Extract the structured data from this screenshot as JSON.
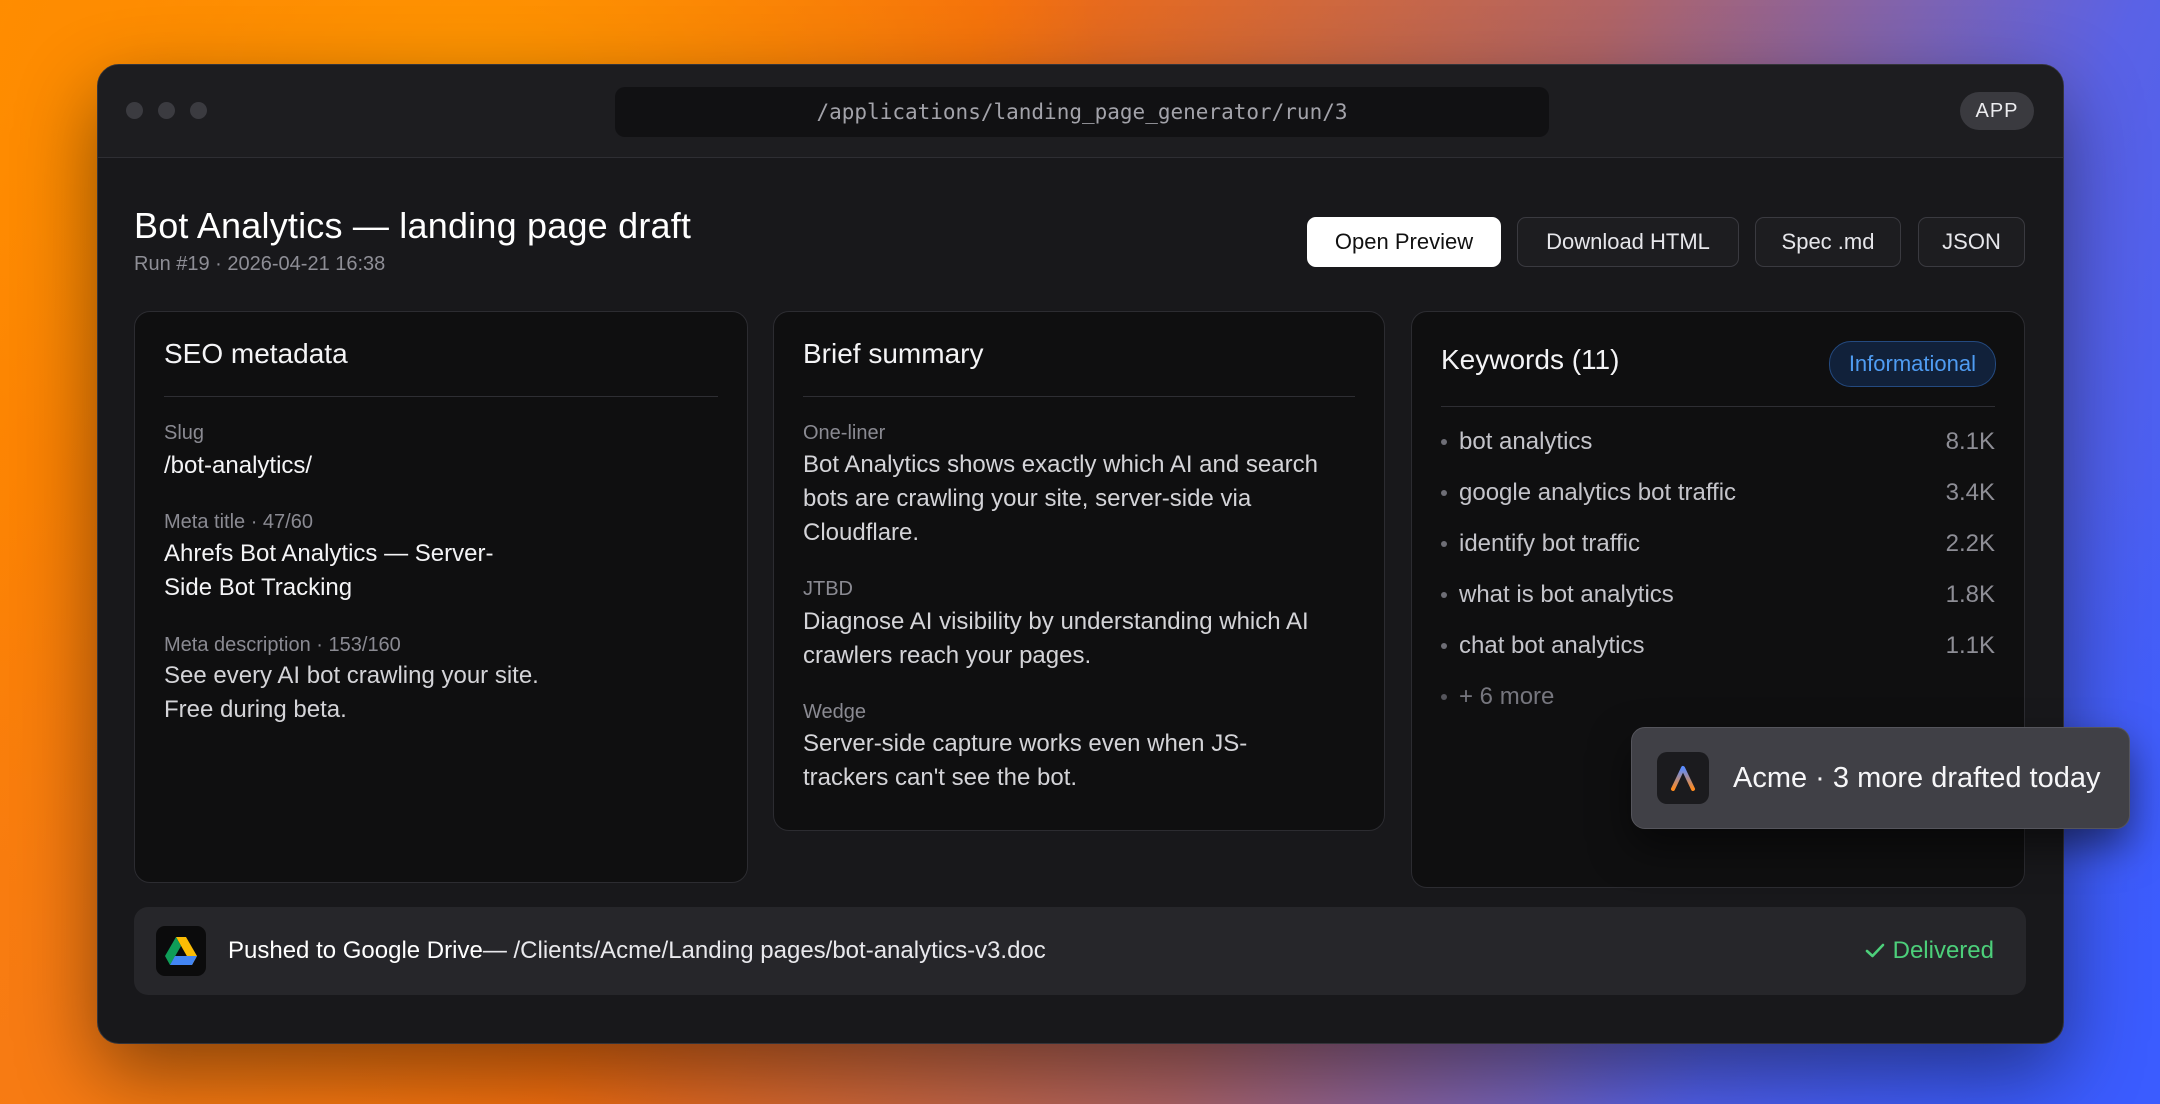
{
  "window": {
    "url": "/applications/landing_page_generator/run/3",
    "badge": "APP"
  },
  "header": {
    "title": "Bot Analytics — landing page draft",
    "subtitle": "Run #19 · 2026-04-21 16:38"
  },
  "actions": {
    "open_preview": "Open Preview",
    "download_html": "Download HTML",
    "spec_md": "Spec .md",
    "json": "JSON"
  },
  "seo": {
    "title": "SEO metadata",
    "slug_label": "Slug",
    "slug": "/bot-analytics/",
    "meta_title_label": "Meta title · 47/60",
    "meta_title_line1": "Ahrefs Bot Analytics — Server-",
    "meta_title_line2": "Side Bot Tracking",
    "meta_desc_label": "Meta description · 153/160",
    "meta_desc_line1": "See every AI bot crawling your site.",
    "meta_desc_line2": "Free during beta."
  },
  "brief": {
    "title": "Brief summary",
    "oneliner_label": "One-liner",
    "oneliner_lines": [
      "Bot Analytics shows exactly which AI and search",
      "bots are crawling your site, server-side via",
      "Cloudflare."
    ],
    "jtbd_label": "JTBD",
    "jtbd_lines": [
      "Diagnose AI visibility by understanding which AI",
      "crawlers reach your pages."
    ],
    "wedge_label": "Wedge",
    "wedge_lines": [
      "Server-side capture works even when JS-",
      "trackers can't see the bot."
    ]
  },
  "keywords": {
    "title": "Keywords (11)",
    "intent": "Informational",
    "items": [
      {
        "term": "bot analytics",
        "volume": "8.1K"
      },
      {
        "term": "google analytics bot traffic",
        "volume": "3.4K"
      },
      {
        "term": "identify bot traffic",
        "volume": "2.2K"
      },
      {
        "term": "what is bot analytics",
        "volume": "1.8K"
      },
      {
        "term": "chat bot analytics",
        "volume": "1.1K"
      }
    ],
    "more": "+ 6 more"
  },
  "footer": {
    "pushed": "Pushed to Google Drive",
    "path": " — /Clients/Acme/Landing pages/bot-analytics-v3.doc",
    "status": "Delivered"
  },
  "toast": {
    "text": "Acme · 3 more drafted today"
  },
  "colors": {
    "accent_blue": "#4f9cf2",
    "success_green": "#4ccf7a",
    "window_bg": "#18181b"
  }
}
